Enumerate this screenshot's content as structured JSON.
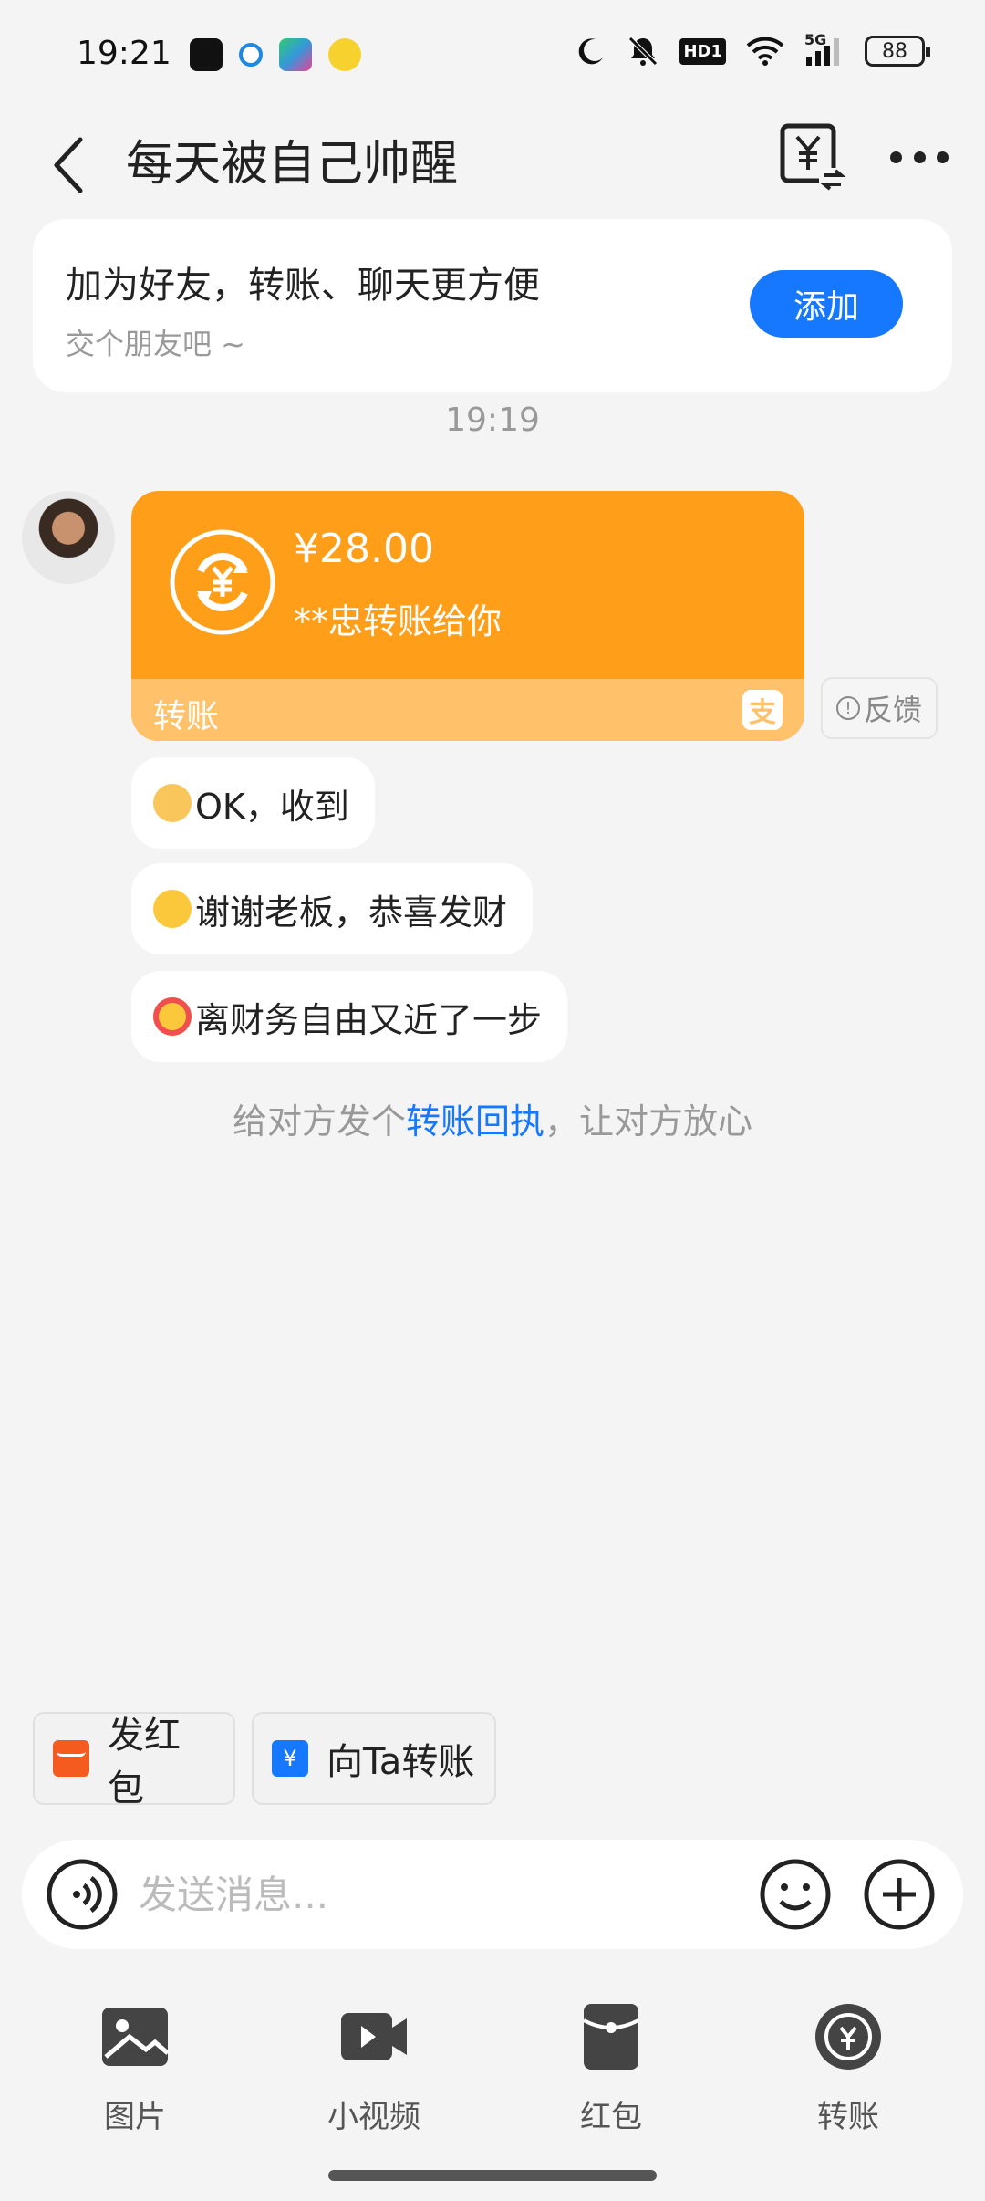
{
  "status_bar": {
    "time": "19:21",
    "battery": "88",
    "network": "5G",
    "hd_label": "HD1",
    "app_icons": [
      "dewu-app-icon",
      "search-app-icon",
      "video-app-icon",
      "game-app-icon"
    ]
  },
  "header": {
    "title": "每天被自己帅醒",
    "back_icon": "chevron-left-icon",
    "transfer_icon": "yuan-transfer-icon",
    "more_icon": "more-dots-icon"
  },
  "add_friend": {
    "title": "加为好友，转账、聊天更方便",
    "subtitle": "交个朋友吧 ~",
    "button": "添加"
  },
  "timestamp": "19:19",
  "transfer": {
    "amount": "¥28.00",
    "description": "**忠转账给你",
    "label": "转账",
    "alipay_icon": "支",
    "feedback": "反馈",
    "color": "#ff9e18",
    "footer_color": "#ffc169"
  },
  "messages": [
    {
      "emoji": "ok-hand-emoji",
      "text": "OK，收到"
    },
    {
      "emoji": "hand-over-mouth-emoji",
      "text": "谢谢老板，恭喜发财"
    },
    {
      "emoji": "star-struck-emoji",
      "text": "离财务自由又近了一步"
    }
  ],
  "receipt_tip": {
    "before": "给对方发个",
    "link": "转账回执",
    "after": "，让对方放心"
  },
  "quick_actions": {
    "red_packet": "发红包",
    "transfer": "向Ta转账"
  },
  "input": {
    "placeholder": "发送消息..."
  },
  "panel": {
    "items": [
      {
        "label": "图片",
        "icon": "image-icon"
      },
      {
        "label": "小视频",
        "icon": "video-icon"
      },
      {
        "label": "红包",
        "icon": "red-packet-icon"
      },
      {
        "label": "转账",
        "icon": "transfer-icon"
      }
    ]
  },
  "colors": {
    "accent": "#1677ff",
    "background": "#f4f4f4"
  }
}
